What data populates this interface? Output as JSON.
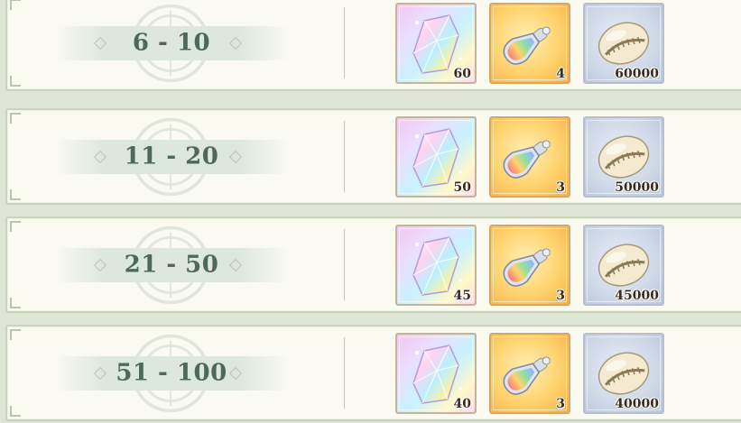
{
  "rows": [
    {
      "range": "6 - 10",
      "rewards": [
        {
          "item": "crystal",
          "icon": "rainbow-crystal-icon",
          "qty": "60"
        },
        {
          "item": "potion",
          "icon": "potion-vial-icon",
          "qty": "4"
        },
        {
          "item": "shell",
          "icon": "cowrie-shell-icon",
          "qty": "60000"
        }
      ]
    },
    {
      "range": "11 - 20",
      "rewards": [
        {
          "item": "crystal",
          "icon": "rainbow-crystal-icon",
          "qty": "50"
        },
        {
          "item": "potion",
          "icon": "potion-vial-icon",
          "qty": "3"
        },
        {
          "item": "shell",
          "icon": "cowrie-shell-icon",
          "qty": "50000"
        }
      ]
    },
    {
      "range": "21 - 50",
      "rewards": [
        {
          "item": "crystal",
          "icon": "rainbow-crystal-icon",
          "qty": "45"
        },
        {
          "item": "potion",
          "icon": "potion-vial-icon",
          "qty": "3"
        },
        {
          "item": "shell",
          "icon": "cowrie-shell-icon",
          "qty": "45000"
        }
      ]
    },
    {
      "range": "51 - 100",
      "rewards": [
        {
          "item": "crystal",
          "icon": "rainbow-crystal-icon",
          "qty": "40"
        },
        {
          "item": "potion",
          "icon": "potion-vial-icon",
          "qty": "3"
        },
        {
          "item": "shell",
          "icon": "cowrie-shell-icon",
          "qty": "40000"
        }
      ]
    }
  ],
  "colors": {
    "panel": "#fafaf0",
    "border": "#c9d4bb",
    "range_text": "#4d6a58",
    "qty_text": "#3a2a1a"
  }
}
